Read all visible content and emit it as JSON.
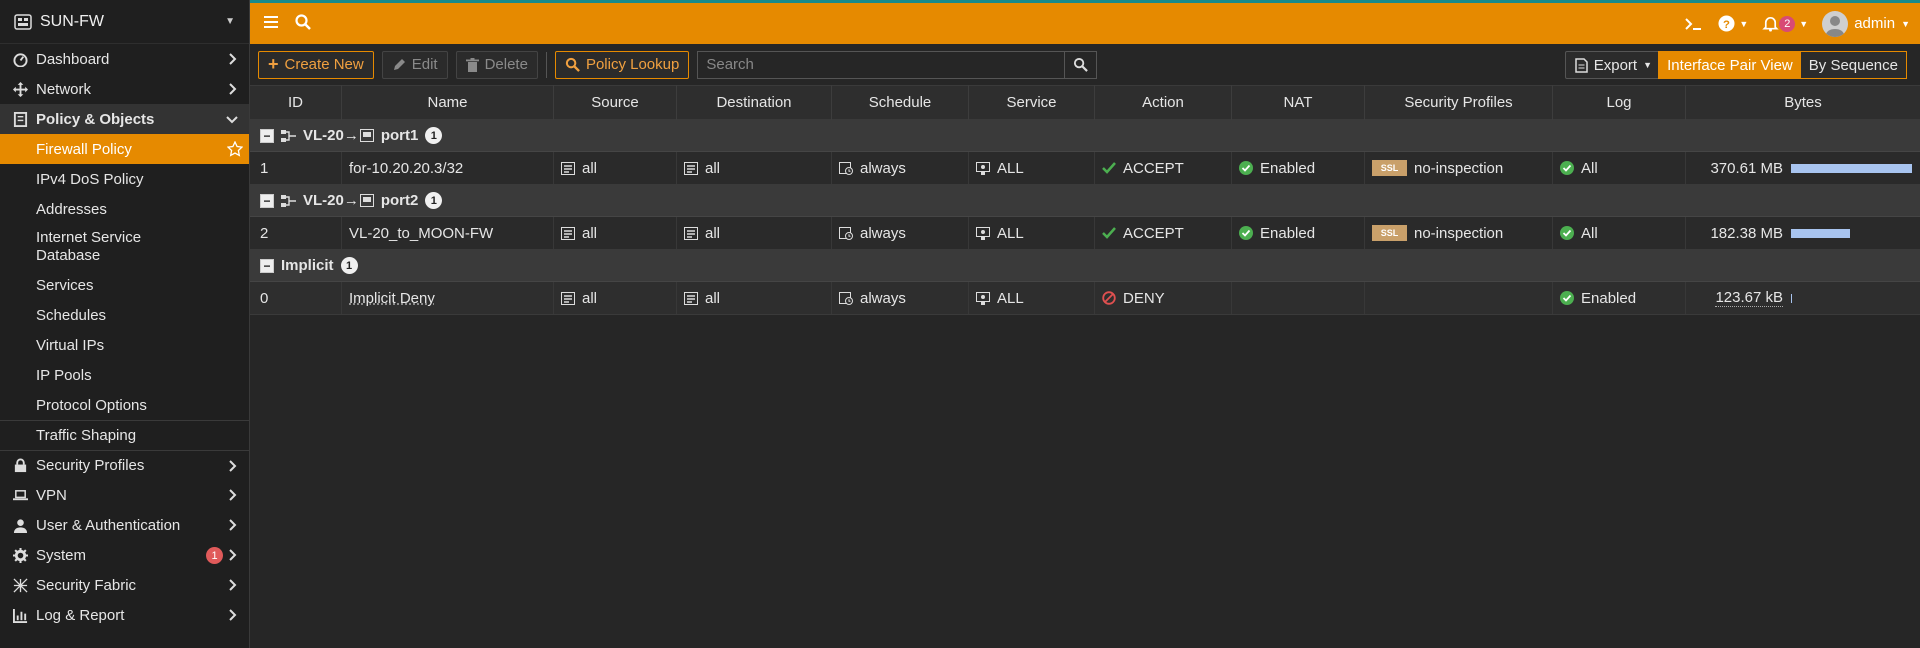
{
  "device": {
    "name": "SUN-FW"
  },
  "sidebar": {
    "items": [
      {
        "label": "Dashboard"
      },
      {
        "label": "Network"
      },
      {
        "label": "Policy & Objects"
      },
      {
        "label": "Firewall Policy"
      },
      {
        "label": "IPv4 DoS Policy"
      },
      {
        "label": "Addresses"
      },
      {
        "label": "Internet Service Database"
      },
      {
        "label": "Services"
      },
      {
        "label": "Schedules"
      },
      {
        "label": "Virtual IPs"
      },
      {
        "label": "IP Pools"
      },
      {
        "label": "Protocol Options"
      },
      {
        "label": "Traffic Shaping"
      },
      {
        "label": "Security Profiles"
      },
      {
        "label": "VPN"
      },
      {
        "label": "User & Authentication"
      },
      {
        "label": "System",
        "badge": "1"
      },
      {
        "label": "Security Fabric"
      },
      {
        "label": "Log & Report"
      }
    ]
  },
  "topbar": {
    "notifications": "2",
    "user": "admin"
  },
  "toolbar": {
    "create_new": "Create New",
    "edit": "Edit",
    "delete": "Delete",
    "policy_lookup": "Policy Lookup",
    "search_placeholder": "Search",
    "export": "Export",
    "view_interface_pair": "Interface Pair View",
    "view_by_sequence": "By Sequence"
  },
  "table": {
    "columns": [
      "ID",
      "Name",
      "Source",
      "Destination",
      "Schedule",
      "Service",
      "Action",
      "NAT",
      "Security Profiles",
      "Log",
      "Bytes"
    ],
    "groups": [
      {
        "from": "VL-20",
        "arrow": "→",
        "to": "port1",
        "count": "1",
        "rows": [
          {
            "id": "1",
            "name": "for-10.20.20.3/32",
            "source": "all",
            "destination": "all",
            "schedule": "always",
            "service": "ALL",
            "action": "ACCEPT",
            "nat": "Enabled",
            "ssl_badge": "SSL",
            "profile": "no-inspection",
            "log": "All",
            "bytes": "370.61 MB",
            "bytes_fraction": 1.0
          }
        ]
      },
      {
        "from": "VL-20",
        "arrow": "→",
        "to": "port2",
        "count": "1",
        "rows": [
          {
            "id": "2",
            "name": "VL-20_to_MOON-FW",
            "source": "all",
            "destination": "all",
            "schedule": "always",
            "service": "ALL",
            "action": "ACCEPT",
            "nat": "Enabled",
            "ssl_badge": "SSL",
            "profile": "no-inspection",
            "log": "All",
            "bytes": "182.38 MB",
            "bytes_fraction": 0.49
          }
        ]
      },
      {
        "label": "Implicit",
        "count": "1",
        "rows": [
          {
            "id": "0",
            "name": "Implicit Deny",
            "source": "all",
            "destination": "all",
            "schedule": "always",
            "service": "ALL",
            "action": "DENY",
            "log": "Enabled",
            "bytes": "123.67 kB",
            "bytes_fraction": 0.01
          }
        ]
      }
    ]
  },
  "colors": {
    "accent": "#e68a00",
    "accept": "#4caf50",
    "deny": "#e05050",
    "bar": "#a8c4ef"
  }
}
